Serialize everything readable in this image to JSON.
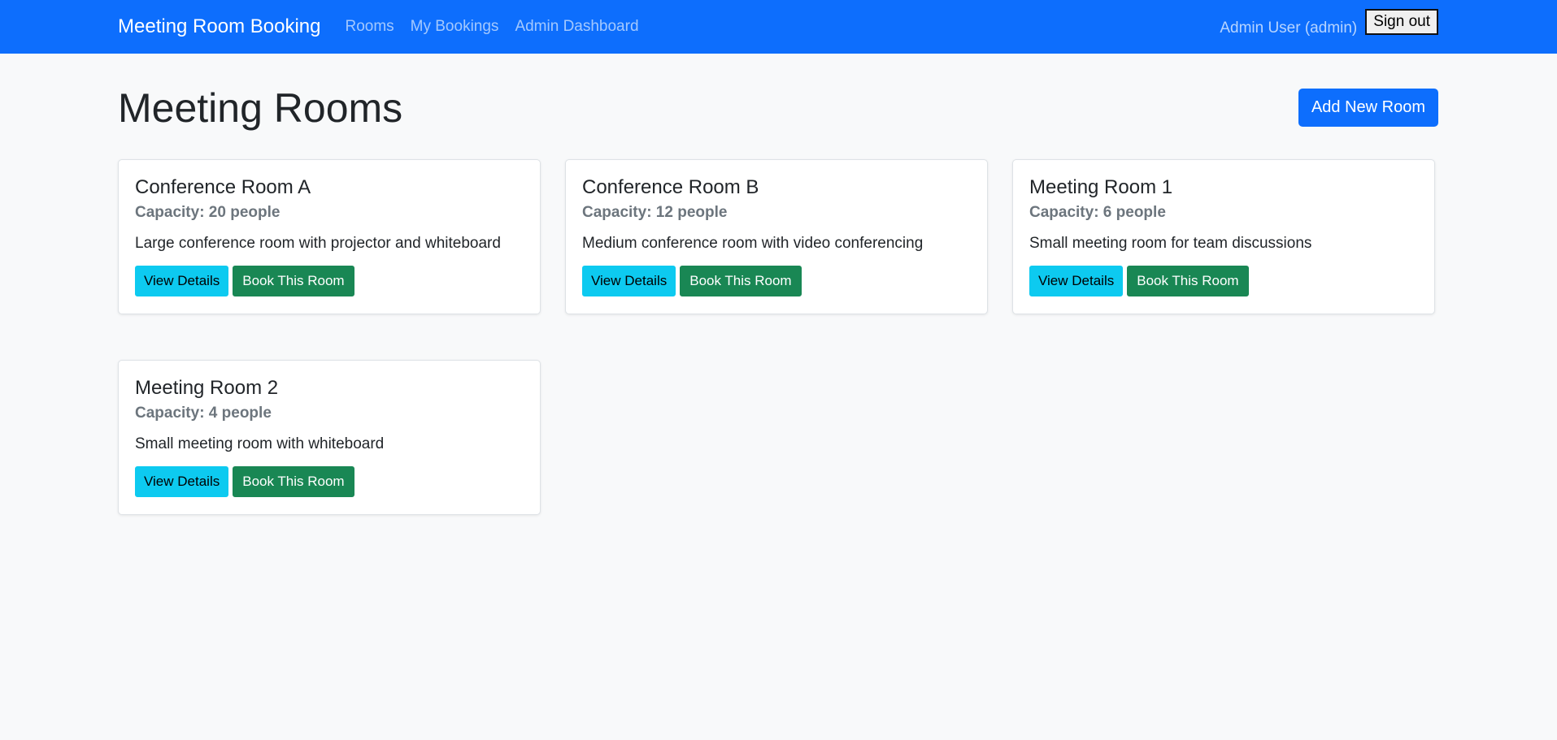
{
  "navbar": {
    "brand": "Meeting Room Booking",
    "links": [
      {
        "label": "Rooms"
      },
      {
        "label": "My Bookings"
      },
      {
        "label": "Admin Dashboard"
      }
    ],
    "user_label": "Admin User (admin)",
    "signout_label": "Sign out"
  },
  "page": {
    "title": "Meeting Rooms",
    "add_button_label": "Add New Room"
  },
  "rooms": [
    {
      "name": "Conference Room A",
      "capacity": "Capacity: 20 people",
      "description": "Large conference room with projector and whiteboard",
      "details_label": "View Details",
      "book_label": "Book This Room"
    },
    {
      "name": "Conference Room B",
      "capacity": "Capacity: 12 people",
      "description": "Medium conference room with video conferencing",
      "details_label": "View Details",
      "book_label": "Book This Room"
    },
    {
      "name": "Meeting Room 1",
      "capacity": "Capacity: 6 people",
      "description": "Small meeting room for team discussions",
      "details_label": "View Details",
      "book_label": "Book This Room"
    },
    {
      "name": "Meeting Room 2",
      "capacity": "Capacity: 4 people",
      "description": "Small meeting room with whiteboard",
      "details_label": "View Details",
      "book_label": "Book This Room"
    }
  ],
  "colors": {
    "primary": "#0d6efd",
    "info": "#0dcaf0",
    "success": "#198754",
    "muted": "#6c757d",
    "background": "#f8f9fa"
  }
}
